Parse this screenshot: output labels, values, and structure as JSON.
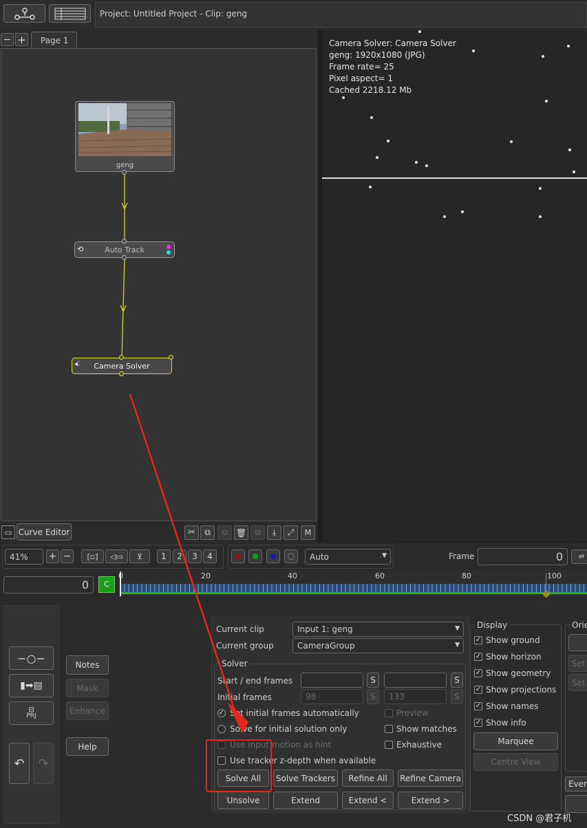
{
  "toolbar": {
    "node_view_icon": "node-graph-icon",
    "list_view_icon": "list-view-icon",
    "title": "Project: Untitled Project - Clip: geng"
  },
  "node_tabs": {
    "page_label": "Page 1"
  },
  "nodes": {
    "clip": {
      "label": "geng"
    },
    "auto_track": {
      "label": "Auto Track"
    },
    "camera_solver": {
      "label": "Camera Solver"
    }
  },
  "viewer": {
    "info": [
      "Camera Solver: Camera Solver",
      "geng: 1920x1080 (JPG)",
      "Frame rate= 25",
      "Pixel aspect= 1",
      "Cached 2218.12 Mb"
    ]
  },
  "node_footer": {
    "curve_editor": "Curve Editor"
  },
  "view_controls": {
    "zoom": "41%",
    "views": [
      "1",
      "2",
      "3",
      "4"
    ],
    "mode_select": "Auto",
    "frame_label": "Frame",
    "frame_value": "0"
  },
  "timeline": {
    "frame_value": "0",
    "c_badge": "C",
    "ticks": [
      "0",
      "20",
      "40",
      "60",
      "80",
      "100"
    ]
  },
  "left_panel": {
    "notes": "Notes",
    "mask": "Mask",
    "enhance": "Enhance",
    "help": "Help",
    "prj_label": "PRJ"
  },
  "solver_panel": {
    "current_clip_label": "Current clip",
    "current_clip_value": "Input 1: geng",
    "current_group_label": "Current group",
    "current_group_value": "CameraGroup",
    "solver_title": "Solver",
    "start_end_label": "Start / end frames",
    "initial_frames_label": "Initial frames",
    "initial_frame_a": "98",
    "initial_frame_b": "133",
    "s_label": "S",
    "set_initial_auto": "Set initial frames automatically",
    "solve_initial_only": "Solve for initial solution only",
    "use_input_motion": "Use input motion as hint",
    "use_tracker_depth": "Use tracker z-depth when available",
    "preview": "Preview",
    "show_matches": "Show matches",
    "exhaustive": "Exhaustive",
    "solve_all": "Solve All",
    "solve_trackers": "Solve Trackers",
    "refine_all": "Refine All",
    "refine_camera": "Refine Camera",
    "unsolve": "Unsolve",
    "extend": "Extend",
    "extend_back": "Extend <",
    "extend_fwd": "Extend >"
  },
  "display_panel": {
    "title": "Display",
    "items": [
      "Show ground",
      "Show horizon",
      "Show geometry",
      "Show projections",
      "Show names",
      "Show info"
    ],
    "marquee": "Marquee",
    "centre_view": "Centre View"
  },
  "orient_panel": {
    "title": "Orie",
    "set_a": "Set",
    "set_b": "Set",
    "every": "Every"
  },
  "watermark": "CSDN @君子机",
  "colors": {
    "node_link": "#d8d820",
    "annotation_red": "#e8261c",
    "timeline_green": "#19c019",
    "c_badge": "#1a9e1a"
  }
}
